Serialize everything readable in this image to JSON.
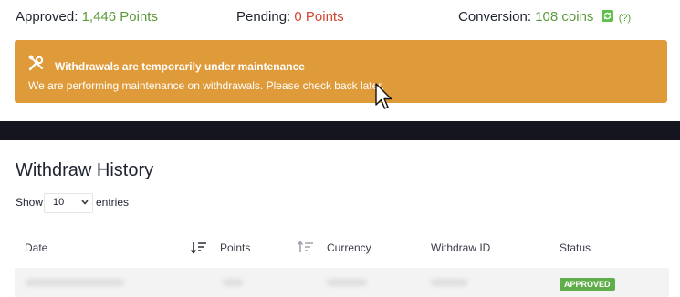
{
  "stats": {
    "approved_label": "Approved:",
    "approved_value": "1,446 Points",
    "pending_label": "Pending:",
    "pending_value": "0 Points",
    "conversion_label": "Conversion:",
    "conversion_value": "108 coins",
    "conversion_help": "(?)"
  },
  "banner": {
    "icon": "wrench-screwdriver-icon",
    "title": "Withdrawals are temporarily under maintenance",
    "text": "We are performing maintenance on withdrawals. Please check back later.",
    "color": "#df9a3a"
  },
  "history": {
    "title": "Withdraw History",
    "show_label": "Show",
    "entries_value": "10",
    "entries_label": "entries",
    "columns": [
      "Date",
      "Points",
      "Currency",
      "Withdraw ID",
      "Status"
    ],
    "rows": [
      {
        "status": "APPROVED"
      }
    ]
  },
  "colors": {
    "positive": "#5a9a3a",
    "negative": "#d0452f",
    "dark_bar": "#14151f",
    "status_approved": "#5fae4a"
  }
}
